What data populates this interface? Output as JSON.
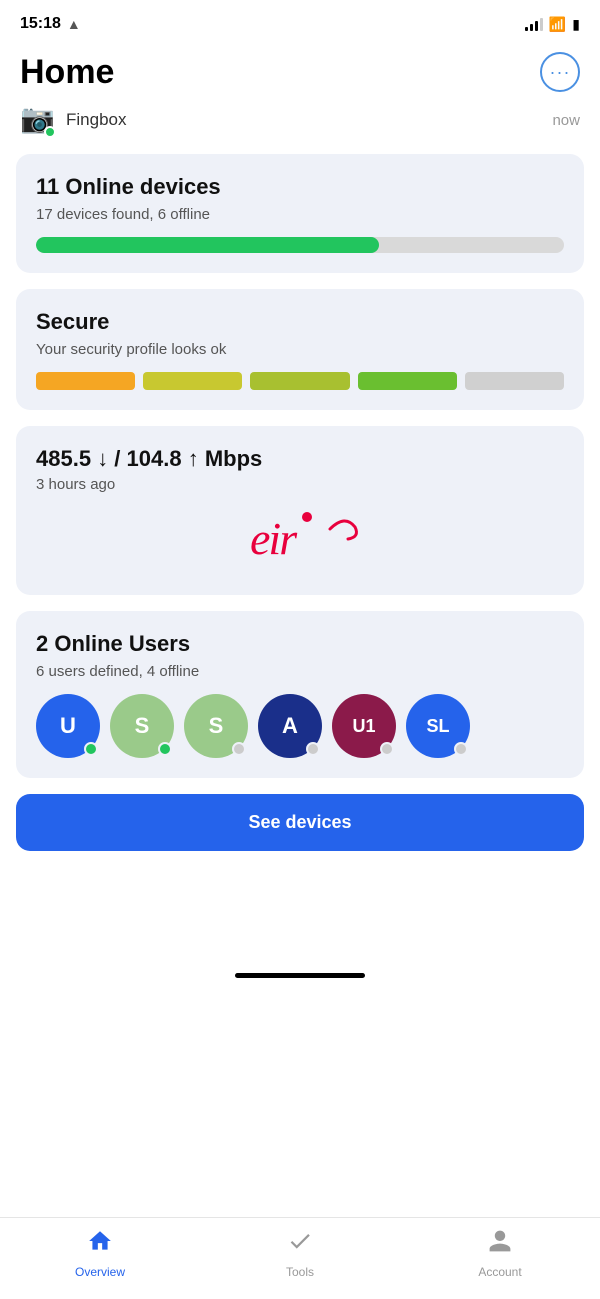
{
  "statusBar": {
    "time": "15:18",
    "signalBars": [
      4,
      7,
      10,
      13
    ],
    "hasWifi": true,
    "batteryLevel": 85
  },
  "header": {
    "title": "Home",
    "moreButtonLabel": "···"
  },
  "fingbox": {
    "name": "Fingbox",
    "time": "now"
  },
  "onlineDevicesCard": {
    "title": "11 Online devices",
    "subtitle": "17 devices found, 6 offline",
    "onlineCount": 11,
    "totalCount": 17,
    "progressPercent": 65
  },
  "secureCard": {
    "title": "Secure",
    "subtitle": "Your security profile looks ok",
    "bars": [
      {
        "color": "#f5a623"
      },
      {
        "color": "#c8c830"
      },
      {
        "color": "#a8c030"
      },
      {
        "color": "#6abf30"
      },
      {
        "color": "#d0d0d0"
      }
    ]
  },
  "speedCard": {
    "download": "485.5",
    "upload": "104.8",
    "unit": "Mbps",
    "time": "3 hours ago",
    "isp": "eir"
  },
  "onlineUsersCard": {
    "title": "2 Online Users",
    "subtitle": "6 users defined, 4 offline",
    "users": [
      {
        "initials": "U",
        "color": "#2563eb",
        "online": true
      },
      {
        "initials": "S",
        "color": "#9aca8a",
        "online": true
      },
      {
        "initials": "S",
        "color": "#9aca8a",
        "online": false
      },
      {
        "initials": "A",
        "color": "#1a2f8a",
        "online": false
      },
      {
        "initials": "U1",
        "color": "#8b1a4a",
        "online": false
      },
      {
        "initials": "SL",
        "color": "#2563eb",
        "online": false
      }
    ]
  },
  "seeDevicesButton": {
    "label": "See devices"
  },
  "bottomNav": {
    "items": [
      {
        "id": "overview",
        "label": "Overview",
        "active": true
      },
      {
        "id": "tools",
        "label": "Tools",
        "active": false
      },
      {
        "id": "account",
        "label": "Account",
        "active": false
      }
    ]
  }
}
